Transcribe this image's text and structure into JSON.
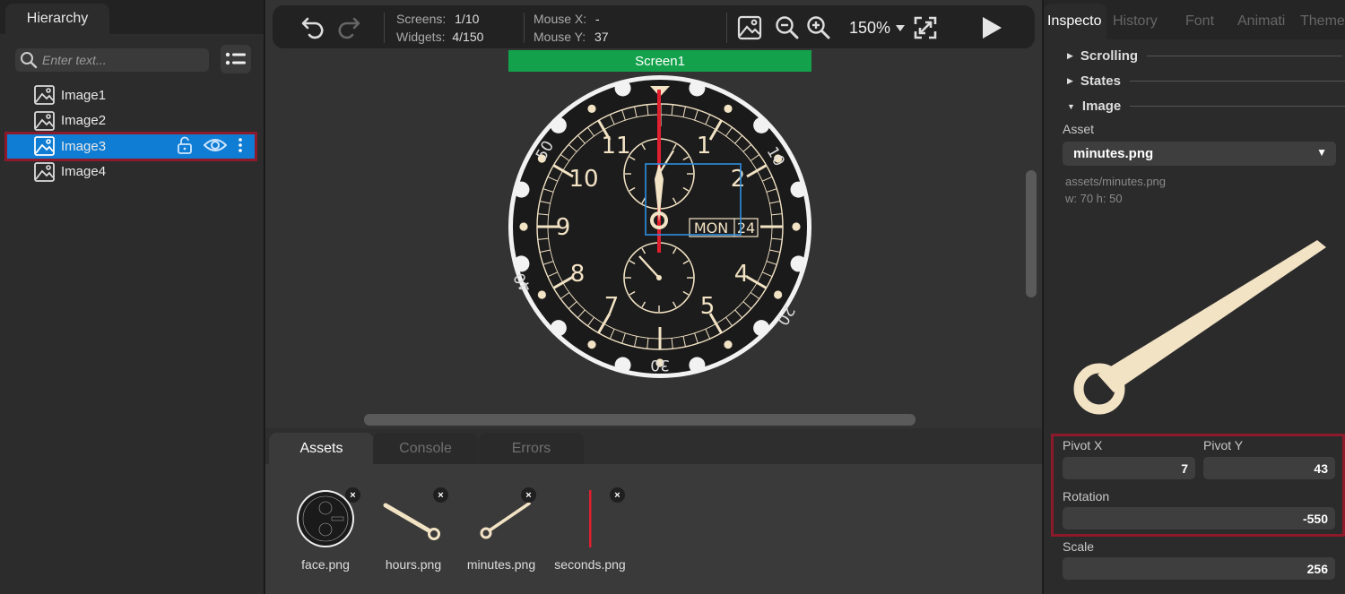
{
  "hierarchy": {
    "tab_label": "Hierarchy",
    "search_placeholder": "Enter text...",
    "items": [
      {
        "label": "Image1"
      },
      {
        "label": "Image2"
      },
      {
        "label": "Image3",
        "selected": true
      },
      {
        "label": "Image4"
      }
    ]
  },
  "toolbar": {
    "screens_label": "Screens:",
    "screens_value": "1/10",
    "widgets_label": "Widgets:",
    "widgets_value": "4/150",
    "mouse_x_label": "Mouse X:",
    "mouse_x_value": "-",
    "mouse_y_label": "Mouse Y:",
    "mouse_y_value": "37",
    "zoom_value": "150%",
    "icons": [
      "undo-icon",
      "redo-icon",
      "image-icon",
      "zoom-out-icon",
      "zoom-in-icon",
      "chevron-down-icon",
      "fit-screen-icon",
      "play-icon"
    ]
  },
  "canvas": {
    "screen_tab": "Screen1",
    "watch": {
      "hour_numerals": [
        "11",
        "1",
        "10",
        "2",
        "9",
        "8",
        "4",
        "7",
        "5"
      ],
      "bezel_numbers": [
        "50",
        "10",
        "40",
        "20",
        "30"
      ],
      "date_window": "MON",
      "date_number": "24"
    }
  },
  "bottom_panel": {
    "tabs": [
      {
        "label": "Assets",
        "active": true
      },
      {
        "label": "Console",
        "active": false
      },
      {
        "label": "Errors",
        "active": false
      }
    ],
    "assets": [
      {
        "name": "face.png"
      },
      {
        "name": "hours.png"
      },
      {
        "name": "minutes.png"
      },
      {
        "name": "seconds.png"
      }
    ],
    "remove_glyph": "×"
  },
  "inspector": {
    "tabs": [
      {
        "label": "Inspecto",
        "active": true
      },
      {
        "label": "History",
        "active": false
      },
      {
        "label": "Font",
        "active": false
      },
      {
        "label": "Animati",
        "active": false
      },
      {
        "label": "Themes",
        "active": false
      }
    ],
    "sections": {
      "scrolling": "Scrolling",
      "states": "States",
      "image": "Image"
    },
    "asset_label": "Asset",
    "asset_value": "minutes.png",
    "asset_path": "assets/minutes.png",
    "asset_size": "w: 70  h: 50",
    "pivot_x_label": "Pivot X",
    "pivot_x_value": "7",
    "pivot_y_label": "Pivot Y",
    "pivot_y_value": "43",
    "rotation_label": "Rotation",
    "rotation_value": "-550",
    "scale_label": "Scale",
    "scale_value": "256"
  },
  "colors": {
    "selection": "#0f7dd4",
    "highlight_border": "#8c1a2a",
    "screen_tab": "#13a24b",
    "second_hand": "#e01f2f",
    "hand_cream": "#f3e3c5"
  }
}
